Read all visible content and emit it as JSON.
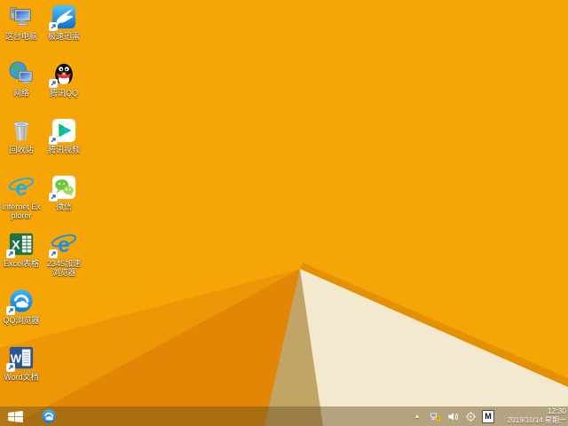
{
  "desktop": {
    "icons": [
      {
        "name": "this-pc",
        "label": "这台电脑",
        "shortcut": false,
        "col": 0,
        "row": 0
      },
      {
        "name": "xunlei",
        "label": "极速迅雷",
        "shortcut": true,
        "col": 1,
        "row": 0
      },
      {
        "name": "network",
        "label": "网络",
        "shortcut": false,
        "col": 0,
        "row": 1
      },
      {
        "name": "tencent-qq",
        "label": "腾讯QQ",
        "shortcut": true,
        "col": 1,
        "row": 1
      },
      {
        "name": "recycle-bin",
        "label": "回收站",
        "shortcut": false,
        "col": 0,
        "row": 2
      },
      {
        "name": "tencent-video",
        "label": "腾讯视频",
        "shortcut": true,
        "col": 1,
        "row": 2
      },
      {
        "name": "internet-explorer",
        "label": "Internet Explorer",
        "shortcut": false,
        "col": 0,
        "row": 3
      },
      {
        "name": "wechat",
        "label": "微信",
        "shortcut": true,
        "col": 1,
        "row": 3
      },
      {
        "name": "excel",
        "label": "Excel表格",
        "shortcut": true,
        "col": 0,
        "row": 4
      },
      {
        "name": "browser-2345",
        "label": "2345加速浏览器",
        "shortcut": true,
        "col": 1,
        "row": 4
      },
      {
        "name": "qq-browser",
        "label": "QQ浏览器",
        "shortcut": true,
        "col": 0,
        "row": 5
      },
      {
        "name": "word",
        "label": "Word文档",
        "shortcut": true,
        "col": 0,
        "row": 6
      }
    ]
  },
  "taskbar": {
    "pinned": [
      {
        "name": "qq-browser"
      }
    ],
    "tray": {
      "icons": [
        {
          "name": "hidden-icons-chevron"
        },
        {
          "name": "network-status"
        },
        {
          "name": "volume"
        },
        {
          "name": "pen-target"
        },
        {
          "name": "ime-indicator",
          "label": "M"
        }
      ],
      "ime_label": "M"
    },
    "clock": {
      "time": "12:30",
      "date": "2019/10/14 星期一"
    }
  },
  "colors": {
    "wp_base": "#F6A507",
    "wp_mid": "#EE9706",
    "wp_dark": "#E28606",
    "wp_tan": "#C2A466",
    "wp_cream": "#F3E9CF",
    "wp_shadow": "#DD8A02"
  }
}
